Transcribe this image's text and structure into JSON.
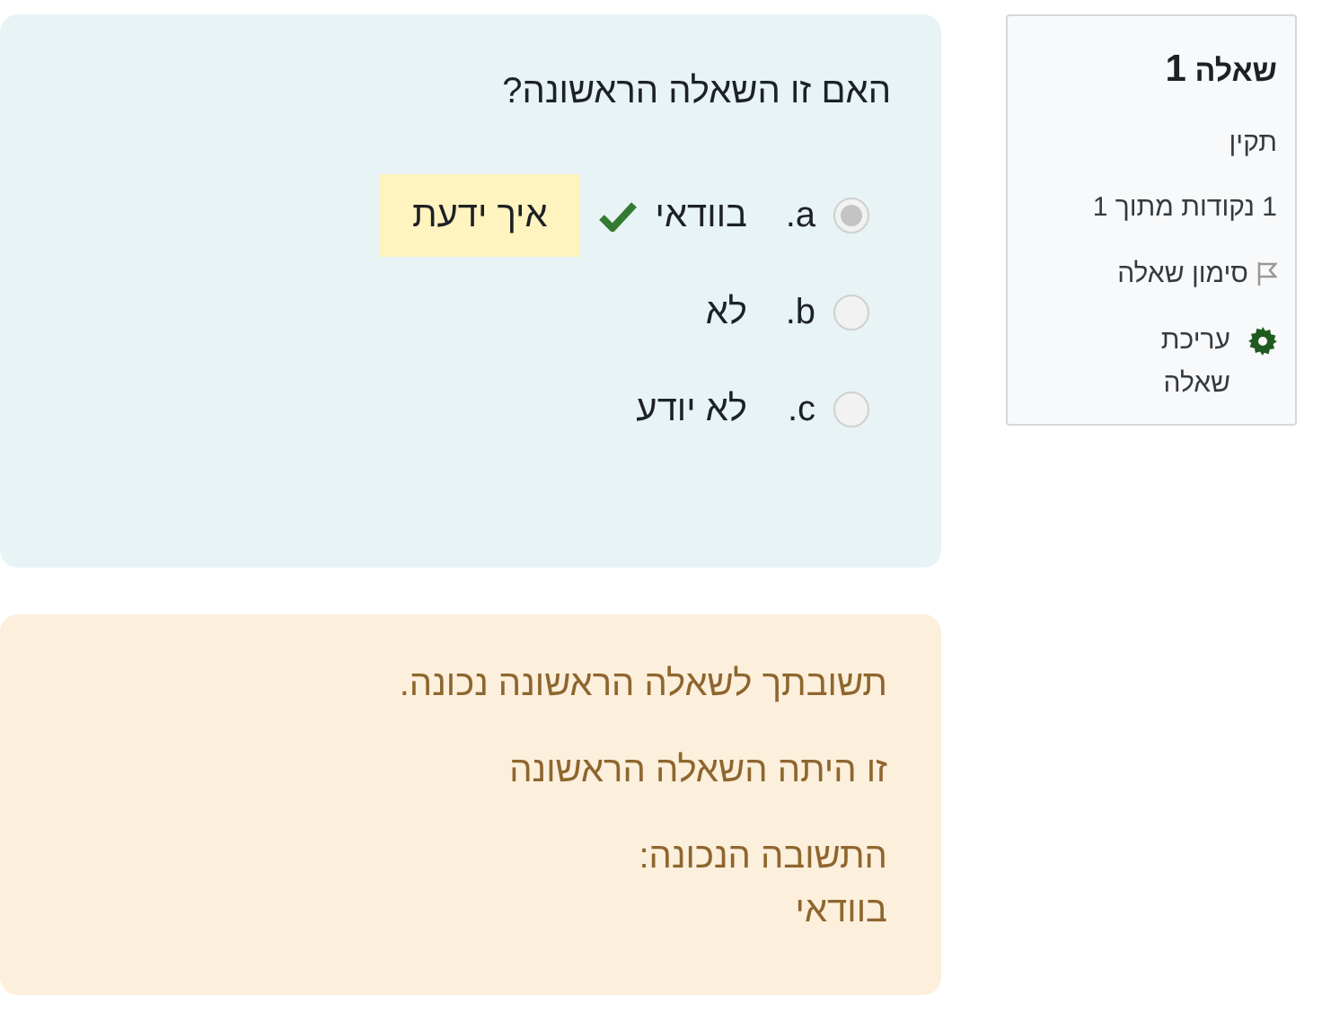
{
  "info": {
    "title": "שאלה",
    "number": "1",
    "state": "תקין",
    "marks": "1 נקודות מתוך 1",
    "flag": {
      "label": "סימון שאלה",
      "flagged": false
    },
    "edit": "עריכת שאלה"
  },
  "question": {
    "text": "האם זו השאלה הראשונה?",
    "options": [
      {
        "letter": "a.",
        "text": "בוודאי",
        "selected": true,
        "correct": true,
        "feedback": "איך ידעת"
      },
      {
        "letter": "b.",
        "text": "לא",
        "selected": false,
        "correct": false
      },
      {
        "letter": "c.",
        "text": "לא יודע",
        "selected": false,
        "correct": false
      }
    ]
  },
  "feedback": {
    "general": "תשובתך לשאלה הראשונה נכונה.",
    "specific": "זו היתה השאלה הראשונה",
    "right_answer_label": "התשובה הנכונה:",
    "right_answer": "בוודאי"
  }
}
